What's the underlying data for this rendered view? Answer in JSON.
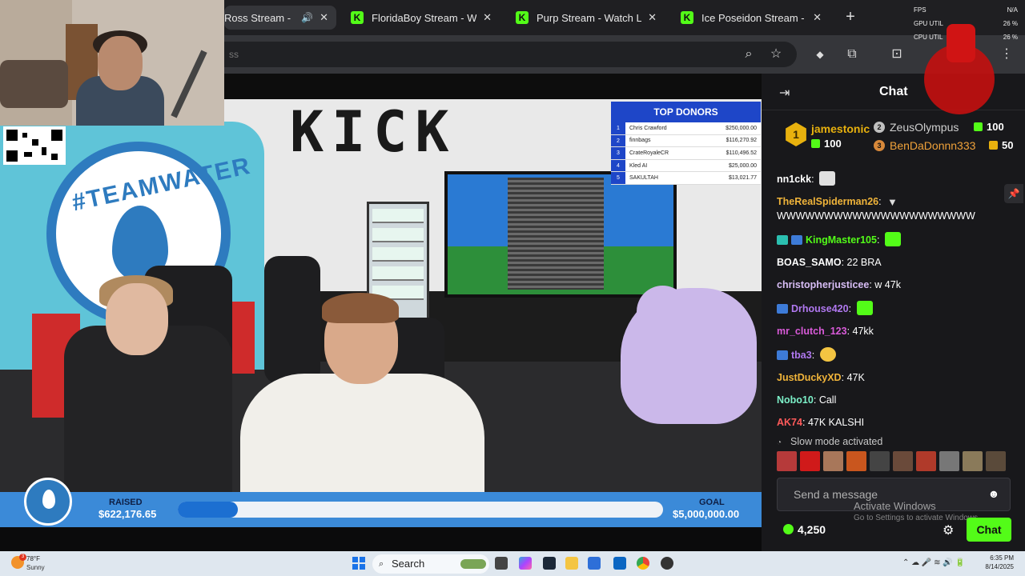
{
  "browser": {
    "tabs": [
      {
        "title": "Ross Stream -",
        "active": true
      },
      {
        "title": "FloridaBoy Stream - W",
        "active": false
      },
      {
        "title": "Purp Stream - Watch L",
        "active": false
      },
      {
        "title": "Ice Poseidon Stream -",
        "active": false
      }
    ],
    "omnibox_fragment": "ss"
  },
  "stream": {
    "wall_logo": "KICK",
    "overlay_brand": "#TEAMWATER",
    "donors": {
      "title": "TOP DONORS",
      "rows": [
        {
          "rank": "1",
          "name": "Chris Crawford",
          "amount": "$250,000.00"
        },
        {
          "rank": "2",
          "name": "finnbags",
          "amount": "$116,270.92"
        },
        {
          "rank": "3",
          "name": "CrateRoyaleCR",
          "amount": "$110,496.52"
        },
        {
          "rank": "4",
          "name": "Kled AI",
          "amount": "$25,000.00"
        },
        {
          "rank": "5",
          "name": "SAKULTAH",
          "amount": "$13,021.77"
        }
      ]
    },
    "fundraiser": {
      "raised_label": "RAISED",
      "raised_value": "$622,176.65",
      "goal_label": "GOAL",
      "goal_value": "$5,000,000.00",
      "progress_fraction": 0.124
    }
  },
  "chat": {
    "title": "Chat",
    "leaderboard": {
      "first": {
        "rank": "1",
        "name": "jamestonic",
        "count": "100"
      },
      "second": {
        "rank": "2",
        "name": "ZeusOlympus",
        "count": "100"
      },
      "third": {
        "rank": "3",
        "name": "BenDaDonnn333",
        "count": "50"
      }
    },
    "messages": [
      {
        "user": "nn1ckk",
        "sep": ":",
        "text": "",
        "color": "#ffffff",
        "emote": true,
        "badges": 0
      },
      {
        "user": "TheRealSpiderman26",
        "sep": ":",
        "text": "",
        "color": "#f0b43a",
        "emote": false,
        "badges": 0
      },
      {
        "user": "",
        "sep": "",
        "text": "WWWWWWWWWWWWWWWWWWWWW",
        "color": "#ffffff",
        "emote": false,
        "badges": 0
      },
      {
        "user": "KingMaster105",
        "sep": ":",
        "text": "",
        "color": "#53fc18",
        "emote": true,
        "badges": 2
      },
      {
        "user": "BOAS_SAMO",
        "sep": ":",
        "text": "22 BRA",
        "color": "#ffffff",
        "emote": false,
        "badges": 0
      },
      {
        "user": "christopherjusticee",
        "sep": ":",
        "text": "w 47k",
        "color": "#d7bdf5",
        "emote": false,
        "badges": 0
      },
      {
        "user": "Drhouse420",
        "sep": ":",
        "text": "",
        "color": "#b078f0",
        "emote": true,
        "badges": 1
      },
      {
        "user": "mr_clutch_123",
        "sep": ":",
        "text": "47kk",
        "color": "#d85ad8",
        "emote": false,
        "badges": 0
      },
      {
        "user": "tba3",
        "sep": ":",
        "text": "",
        "color": "#b078f0",
        "emote": true,
        "badges": 1
      },
      {
        "user": "JustDuckyXD",
        "sep": ":",
        "text": "47K",
        "color": "#f0b43a",
        "emote": false,
        "badges": 0
      },
      {
        "user": "Nobo10",
        "sep": ":",
        "text": "Call",
        "color": "#7cf0c8",
        "emote": false,
        "badges": 0
      },
      {
        "user": "AK74",
        "sep": ":",
        "text": "47K KALSHI",
        "color": "#ff5a5a",
        "emote": false,
        "badges": 0
      }
    ],
    "slow_mode": "Slow mode activated",
    "input_placeholder": "Send a message",
    "watermark_title": "Activate Windows",
    "watermark_sub": "Go to Settings to activate Windows.",
    "points": "4,250",
    "send_label": "Chat",
    "accent_color": "#53fc18"
  },
  "perf": {
    "fps_label": "FPS",
    "fps_value": "N/A",
    "gpu_label": "GPU UTIL",
    "gpu_value": "26 %",
    "cpu_label": "CPU UTIL",
    "cpu_value": "26 %"
  },
  "taskbar": {
    "weather_temp": "78°F",
    "weather_cond": "Sunny",
    "weather_badge": "3",
    "search_label": "Search",
    "time": "6:35 PM",
    "date": "8/14/2025"
  }
}
